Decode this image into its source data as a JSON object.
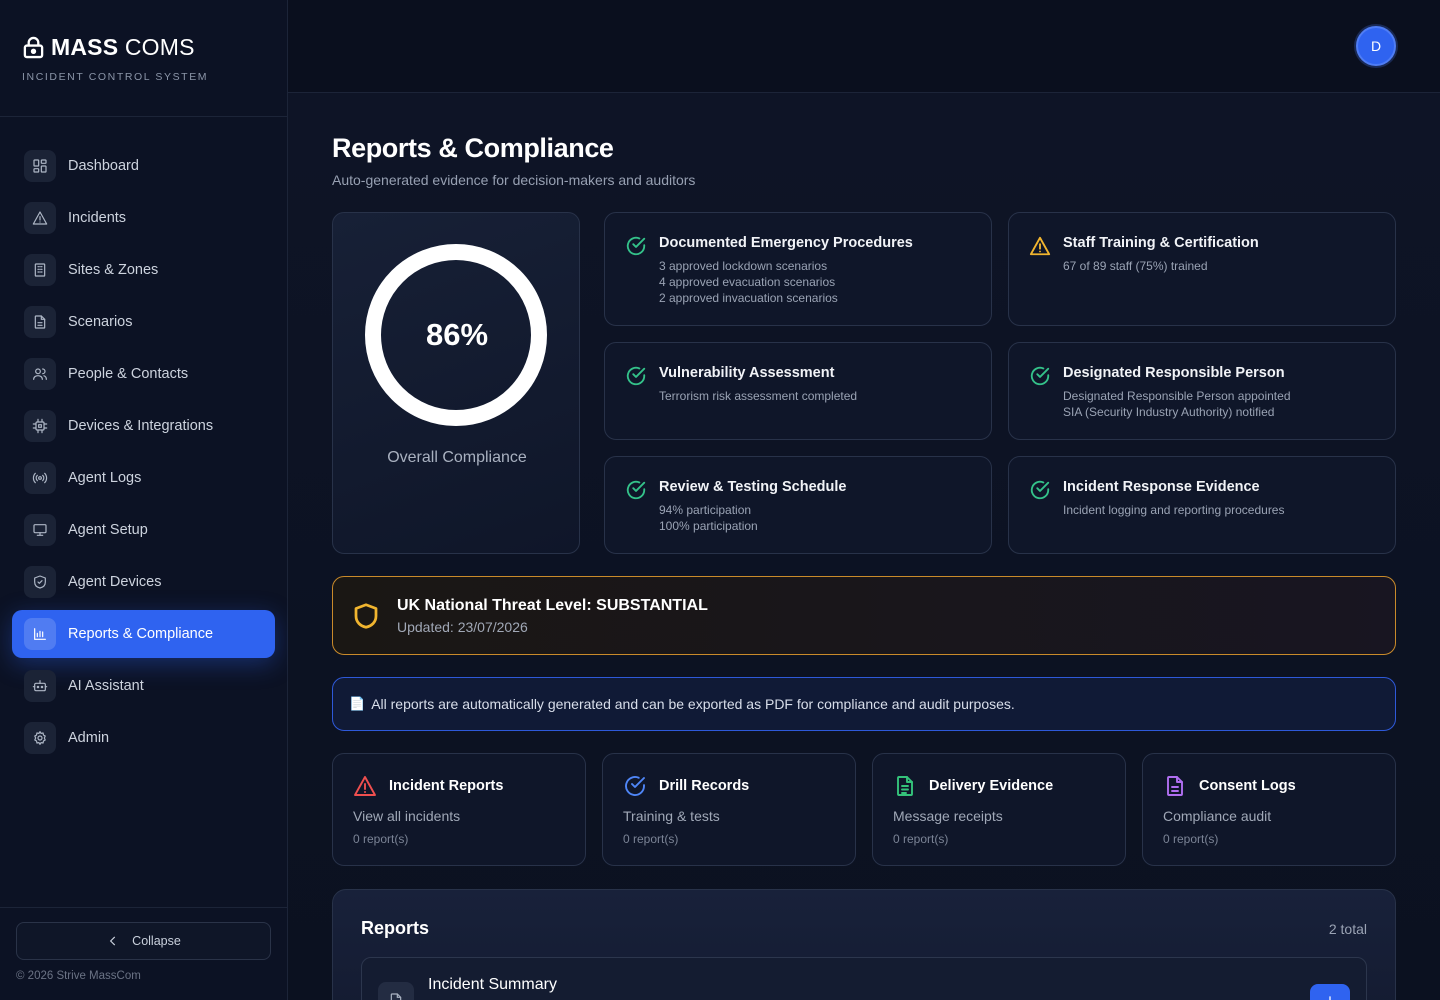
{
  "brand": {
    "name_bold": "MASS",
    "name_light": "COMS",
    "subtitle": "INCIDENT CONTROL SYSTEM"
  },
  "sidebar": {
    "items": [
      {
        "label": "Dashboard",
        "icon": "grid-icon"
      },
      {
        "label": "Incidents",
        "icon": "alert-triangle-icon"
      },
      {
        "label": "Sites & Zones",
        "icon": "building-icon"
      },
      {
        "label": "Scenarios",
        "icon": "file-text-icon"
      },
      {
        "label": "People & Contacts",
        "icon": "users-icon"
      },
      {
        "label": "Devices & Integrations",
        "icon": "chip-icon"
      },
      {
        "label": "Agent Logs",
        "icon": "radio-icon"
      },
      {
        "label": "Agent Setup",
        "icon": "monitor-icon"
      },
      {
        "label": "Agent Devices",
        "icon": "shield-check-icon"
      },
      {
        "label": "Reports & Compliance",
        "icon": "bar-chart-icon",
        "active": true
      },
      {
        "label": "AI Assistant",
        "icon": "bot-icon"
      },
      {
        "label": "Admin",
        "icon": "gear-icon"
      }
    ],
    "collapse_label": "Collapse",
    "copyright": "© 2026 Strive MassCom"
  },
  "header": {
    "avatar_initial": "D"
  },
  "page": {
    "title": "Reports & Compliance",
    "subtitle": "Auto-generated evidence for decision-makers and auditors"
  },
  "compliance": {
    "overall_value": "86%",
    "overall_fraction": 0.86,
    "overall_label": "Overall Compliance",
    "requirements": [
      {
        "title": "Documented Emergency Procedures",
        "status": "complete",
        "lines": [
          "3 approved lockdown scenarios",
          "4 approved evacuation scenarios",
          "2 approved invacuation scenarios"
        ]
      },
      {
        "title": "Staff Training & Certification",
        "status": "warning",
        "lines": [
          "67 of 89 staff (75%) trained"
        ]
      },
      {
        "title": "Vulnerability Assessment",
        "status": "complete",
        "lines": [
          "Terrorism risk assessment completed"
        ]
      },
      {
        "title": "Designated Responsible Person",
        "status": "complete",
        "lines": [
          "Designated Responsible Person appointed",
          "SIA (Security Industry Authority) notified"
        ]
      },
      {
        "title": "Review & Testing Schedule",
        "status": "complete",
        "lines": [
          "94% participation",
          "100% participation"
        ]
      },
      {
        "title": "Incident Response Evidence",
        "status": "complete",
        "lines": [
          "Incident logging and reporting procedures"
        ]
      }
    ]
  },
  "threat": {
    "title": "UK National Threat Level: SUBSTANTIAL",
    "updated": "Updated: 23/07/2026"
  },
  "info_banner": {
    "icon": "📄",
    "text": "All reports are automatically generated and can be exported as PDF for compliance and audit purposes."
  },
  "report_types": [
    {
      "title": "Incident Reports",
      "desc": "View all incidents",
      "count": "0 report(s)",
      "icon": "alert-triangle-icon",
      "color": "#ef4f4f"
    },
    {
      "title": "Drill Records",
      "desc": "Training & tests",
      "count": "0 report(s)",
      "icon": "check-circle-icon",
      "color": "#4f86f7"
    },
    {
      "title": "Delivery Evidence",
      "desc": "Message receipts",
      "count": "0 report(s)",
      "icon": "file-text-icon",
      "color": "#34c27a"
    },
    {
      "title": "Consent Logs",
      "desc": "Compliance audit",
      "count": "0 report(s)",
      "icon": "file-icon",
      "color": "#b06ef0"
    }
  ],
  "reports": {
    "title": "Reports",
    "total": "2 total",
    "items": [
      {
        "name": "Incident Summary"
      }
    ]
  },
  "colors": {
    "accent": "#2f63f0",
    "success": "#34c28a",
    "warning": "#f1b52f",
    "danger": "#ef4f4f"
  }
}
